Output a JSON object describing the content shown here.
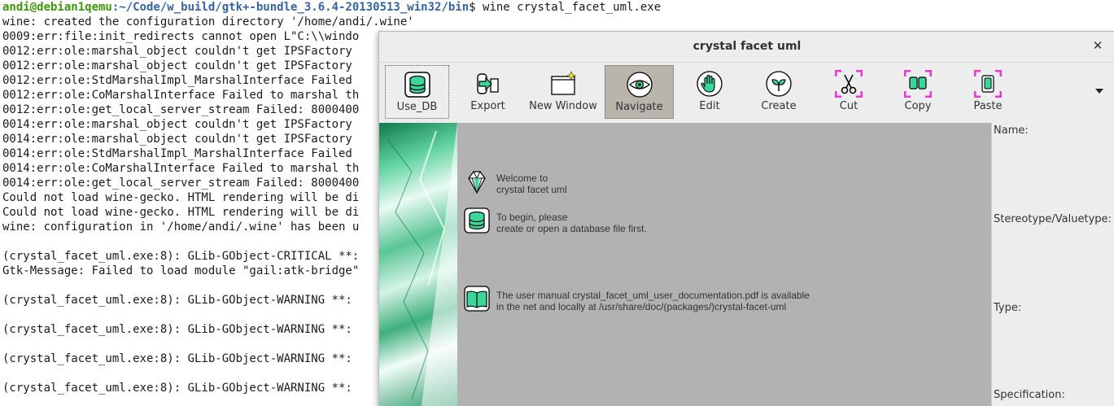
{
  "terminal": {
    "prompt_user": "andi@debian1qemu",
    "prompt_path": ":~/Code/w_build/gtk+-bundle_3.6.4-20130513_win32/bin",
    "prompt_cmd": "$ wine crystal_facet_uml.exe",
    "lines": [
      "wine: created the configuration directory '/home/andi/.wine'",
      "0009:err:file:init_redirects cannot open L\"C:\\\\windo",
      "0012:err:ole:marshal_object couldn't get IPSFactory",
      "0012:err:ole:marshal_object couldn't get IPSFactory",
      "0012:err:ole:StdMarshalImpl_MarshalInterface Failed",
      "0012:err:ole:CoMarshalInterface Failed to marshal th",
      "0012:err:ole:get_local_server_stream Failed: 8000400",
      "0014:err:ole:marshal_object couldn't get IPSFactory",
      "0014:err:ole:marshal_object couldn't get IPSFactory",
      "0014:err:ole:StdMarshalImpl_MarshalInterface Failed",
      "0014:err:ole:CoMarshalInterface Failed to marshal th",
      "0014:err:ole:get_local_server_stream Failed: 8000400",
      "Could not load wine-gecko. HTML rendering will be di",
      "Could not load wine-gecko. HTML rendering will be di",
      "wine: configuration in '/home/andi/.wine' has been u",
      "",
      "(crystal_facet_uml.exe:8): GLib-GObject-CRITICAL **:",
      "Gtk-Message: Failed to load module \"gail:atk-bridge\"",
      "",
      "(crystal_facet_uml.exe:8): GLib-GObject-WARNING **:",
      "",
      "(crystal_facet_uml.exe:8): GLib-GObject-WARNING **:",
      "",
      "(crystal_facet_uml.exe:8): GLib-GObject-WARNING **:",
      "",
      "(crystal_facet_uml.exe:8): GLib-GObject-WARNING **:"
    ]
  },
  "window": {
    "title": "crystal facet uml",
    "close_glyph": "✕"
  },
  "toolbar": {
    "use_db": "Use_DB",
    "export": "Export",
    "new_window": "New Window",
    "navigate": "Navigate",
    "edit": "Edit",
    "create": "Create",
    "cut": "Cut",
    "copy": "Copy",
    "paste": "Paste"
  },
  "canvas": {
    "welcome": "Welcome to\ncrystal facet uml",
    "begin": "To begin, please\ncreate or open a database file first.",
    "manual": "The user manual crystal_facet_uml_user_documentation.pdf is available\nin the net and locally at /usr/share/doc/(packages/)crystal-facet-uml"
  },
  "properties": {
    "name": "Name:",
    "stereotype": "Stereotype/Valuetype:",
    "type": "Type:",
    "specification": "Specification:"
  },
  "colors": {
    "prompt_user": "#3e9a06",
    "prompt_path": "#3465a4",
    "canvas_bg": "#b2b2b2",
    "icon_green": "#3ad69a",
    "icon_magenta": "#e639d8"
  }
}
